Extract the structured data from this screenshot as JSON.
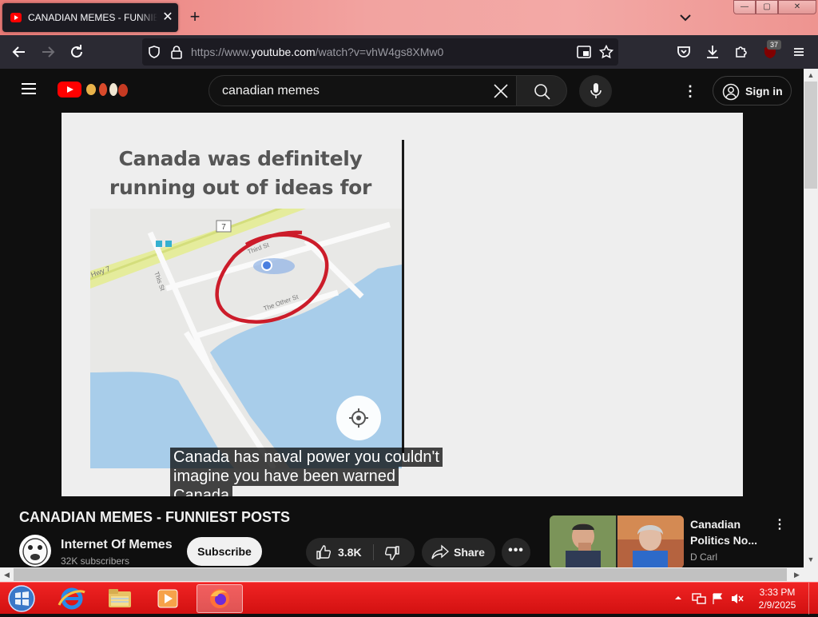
{
  "browser": {
    "tab": {
      "title": "CANADIAN MEMES - FUNNIEST POSTS",
      "close_label": "✕"
    },
    "new_tab_label": "+",
    "window_controls": {
      "minimize": "—",
      "maximize": "▢",
      "close": "✕"
    },
    "address": {
      "prefix": "https://www.",
      "domain": "youtube.com",
      "path": "/watch?v=vhW4gs8XMw0"
    },
    "extensions_badge": "37"
  },
  "youtube": {
    "search": {
      "value": "canadian memes",
      "placeholder": "Search"
    },
    "sign_in_label": "Sign in",
    "more_label": "⋮"
  },
  "video": {
    "meme_caption": "Canada was definitely running out of ideas for street names.",
    "map": {
      "route_label": "7",
      "street_1": "Third St",
      "street_2": "The Other St",
      "street_3": "This St",
      "highway": "Hwy 7"
    },
    "subtitles": [
      "Canada has naval power you couldn't",
      "imagine you have been warned",
      "Canada"
    ],
    "title": "CANADIAN MEMES - FUNNIEST POSTS"
  },
  "channel": {
    "name": "Internet Of Memes",
    "subscribers": "32K subscribers",
    "subscribe_label": "Subscribe"
  },
  "actions": {
    "likes": "3.8K",
    "share_label": "Share",
    "more_label": "•••"
  },
  "recommended": {
    "title": "Canadian Politics No...",
    "channel": "D Carl",
    "more_label": "⋮"
  },
  "scrollbars": {
    "up": "▲",
    "down": "▼",
    "left": "◀",
    "right": "▶"
  },
  "taskbar": {
    "time": "3:33 PM",
    "date": "2/9/2025"
  },
  "colors": {
    "youtube_red": "#ff0000",
    "taskbar_red": "#e01a1a",
    "tab_strip": "#f2a3a0",
    "toolbar": "#2b2a33"
  }
}
